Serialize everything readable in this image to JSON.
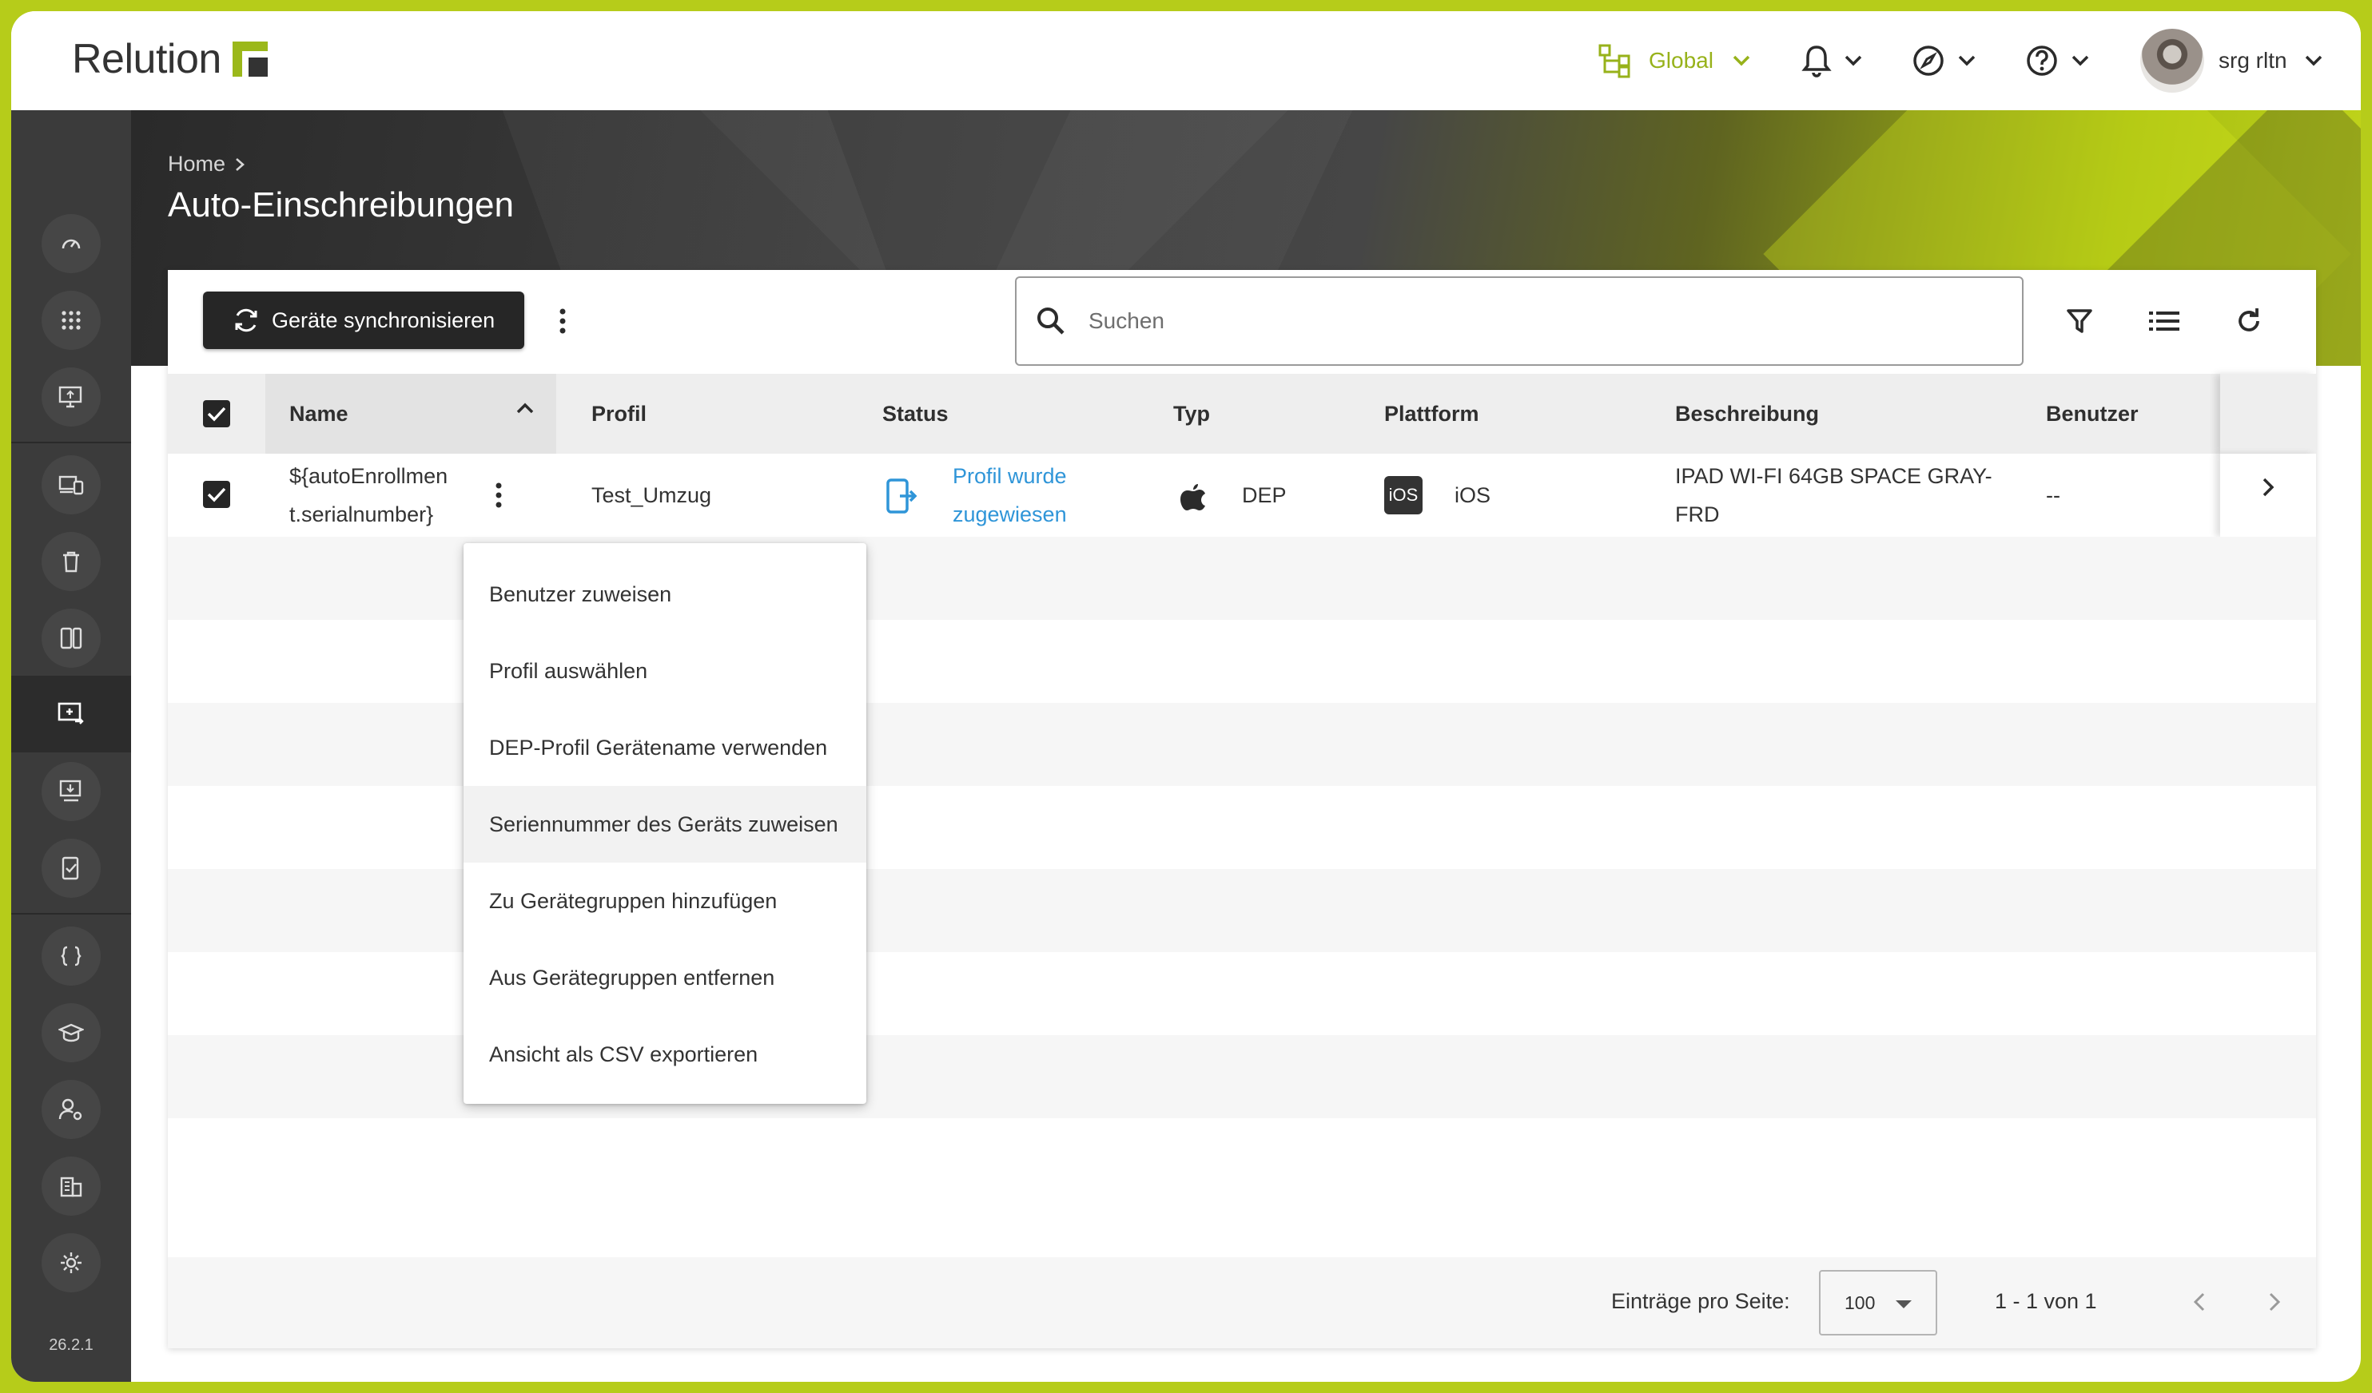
{
  "brand": {
    "name": "Relution"
  },
  "header": {
    "scope_label": "Global",
    "user_name": "srg rltn"
  },
  "sidebar": {
    "version": "26.2.1",
    "items": [
      {
        "icon": "dashboard-icon"
      },
      {
        "icon": "apps-grid-icon"
      },
      {
        "icon": "device-monitor-icon"
      },
      {
        "icon": "devices-icon"
      },
      {
        "icon": "trash-icon"
      },
      {
        "icon": "tablet-phone-icon"
      },
      {
        "icon": "enrollment-icon",
        "active": true
      },
      {
        "icon": "download-device-icon"
      },
      {
        "icon": "compliance-icon"
      },
      {
        "icon": "code-braces-icon"
      },
      {
        "icon": "education-icon"
      },
      {
        "icon": "user-settings-icon"
      },
      {
        "icon": "building-icon"
      },
      {
        "icon": "gear-icon"
      }
    ]
  },
  "breadcrumb": {
    "home": "Home"
  },
  "page": {
    "title": "Auto-Einschreibungen"
  },
  "toolbar": {
    "sync_label": "Geräte synchronisieren",
    "search_placeholder": "Suchen"
  },
  "table": {
    "columns": [
      "Name",
      "Profil",
      "Status",
      "Typ",
      "Plattform",
      "Beschreibung",
      "Benutzer"
    ],
    "rows": [
      {
        "name_line1": "${autoEnrollmen",
        "name_line2": "t.serialnumber}",
        "profil": "Test_Umzug",
        "status_line1": "Profil wurde",
        "status_line2": "zugewiesen",
        "typ": "DEP",
        "plattform_badge": "iOS",
        "plattform": "iOS",
        "beschreibung_line1": "IPAD WI-FI 64GB SPACE GRAY-",
        "beschreibung_line2": "FRD",
        "benutzer": "--"
      }
    ]
  },
  "context_menu": {
    "items": [
      "Benutzer zuweisen",
      "Profil auswählen",
      "DEP-Profil Gerätename verwenden",
      "Seriennummer des Geräts zuweisen",
      "Zu Gerätegruppen hinzufügen",
      "Aus Gerätegruppen entfernen",
      "Ansicht als CSV exportieren"
    ],
    "hovered_index": 3
  },
  "pagination": {
    "per_page_label": "Einträge pro Seite:",
    "per_page_value": "100",
    "range": "1 - 1 von 1"
  },
  "colors": {
    "accent": "#97b21a",
    "link": "#2f95d8",
    "frame": "#b6cc1a",
    "sidebar": "#3b3b3b"
  }
}
